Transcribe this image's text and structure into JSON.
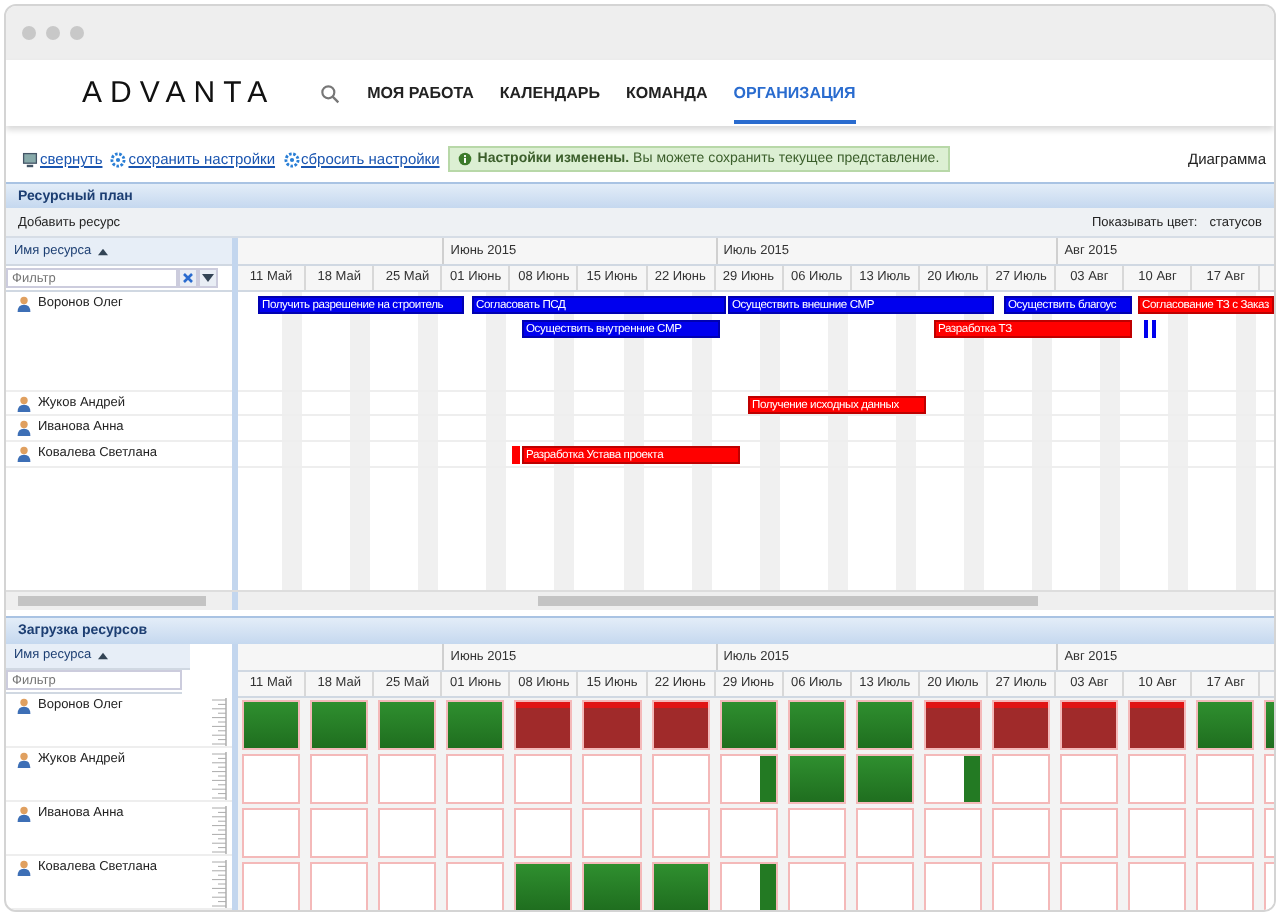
{
  "logo": "ADVANTA",
  "nav": [
    {
      "label": "МОЯ РАБОТА",
      "selected": false
    },
    {
      "label": "КАЛЕНДАРЬ",
      "selected": false
    },
    {
      "label": "КОМАНДА",
      "selected": false
    },
    {
      "label": "ОРГАНИЗАЦИЯ",
      "selected": true
    }
  ],
  "toolbar": {
    "links": [
      "свернуть",
      "сохранить настройки",
      "сбросить настройки"
    ],
    "notice": "**Настройки изменены.** Вы можете сохранить текущее представление.",
    "view_label": "Диаграмма"
  },
  "resource_plan": {
    "title": "Ресурсный план",
    "add_button": "Добавить ресурс",
    "color_label": "Показывать цвет:",
    "color_value": "статусов",
    "name_header": "Имя ресурса",
    "filter_placeholder": "Фильтр",
    "months": [
      "Июнь 2015",
      "Июль 2015",
      "Авг 2015"
    ],
    "weeks": [
      "11 Май",
      "18 Май",
      "25 Май",
      "01 Июнь",
      "08 Июнь",
      "15 Июнь",
      "22 Июнь",
      "29 Июнь",
      "06 Июль",
      "13 Июль",
      "20 Июль",
      "27 Июль",
      "03 Авг",
      "10 Авг",
      "17 Авг"
    ],
    "resources": [
      {
        "name": "Воронов Олег",
        "tasks": [
          {
            "kind": "task",
            "label": "Получить разрешение на строитель",
            "color": "#0000ee"
          },
          {
            "kind": "task",
            "label": "Согласовать ПСД",
            "color": "#0000ee"
          },
          {
            "kind": "task",
            "label": "Осуществить внешние СМР",
            "color": "#0000ee"
          },
          {
            "kind": "task",
            "label": "Осуществить благоус",
            "color": "#0000ee"
          },
          {
            "kind": "task",
            "label": "Согласование ТЗ с Заказ",
            "color": "#ff0000"
          },
          {
            "kind": "task",
            "label": "Осуществить внутренние СМР",
            "color": "#0000ee"
          },
          {
            "kind": "task",
            "label": "Разработка ТЗ",
            "color": "#ff0000"
          },
          {
            "kind": "marker",
            "color": "#0000ee"
          }
        ]
      },
      {
        "name": "Жуков Андрей",
        "tasks": [
          {
            "kind": "task",
            "label": "Получение исходных данных",
            "color": "#ff0000"
          }
        ]
      },
      {
        "name": "Иванова Анна"
      },
      {
        "name": "Ковалева Светлана",
        "tasks": [
          {
            "kind": "marker",
            "color": "#ff0000"
          },
          {
            "kind": "task",
            "label": "Разработка Устава проекта",
            "color": "#ff0000"
          }
        ]
      }
    ]
  },
  "resource_load": {
    "title": "Загрузка ресурсов",
    "name_header": "Имя ресурса",
    "filter_placeholder": "Фильтр",
    "months": [
      "Июнь 2015",
      "Июль 2015",
      "Авг 2015"
    ],
    "weeks": [
      "11 Май",
      "18 Май",
      "25 Май",
      "01 Июнь",
      "08 Июнь",
      "15 Июнь",
      "22 Июнь",
      "29 Июнь",
      "06 Июль",
      "13 Июль",
      "20 Июль",
      "27 Июль",
      "03 Авг",
      "10 Авг",
      "17 Авг"
    ],
    "resources": [
      {
        "name": "Воронов Олег",
        "load": [
          {
            "kind": "busy"
          },
          {
            "kind": "busy"
          },
          {
            "kind": "busy"
          },
          {
            "kind": "busy"
          },
          {
            "kind": "over"
          },
          {
            "kind": "over"
          },
          {
            "kind": "over"
          },
          {
            "kind": "busy"
          },
          {
            "kind": "busy"
          },
          {
            "kind": "busy"
          },
          {
            "kind": "over"
          },
          {
            "kind": "over"
          },
          {
            "kind": "over"
          },
          {
            "kind": "over"
          },
          {
            "kind": "busy"
          },
          {
            "kind": "busy"
          }
        ]
      },
      {
        "name": "Жуков Андрей",
        "load": [
          {
            "kind": "free"
          },
          {
            "kind": "free"
          },
          {
            "kind": "free"
          },
          {
            "kind": "free"
          },
          {
            "kind": "free"
          },
          {
            "kind": "free"
          },
          {
            "kind": "free"
          },
          {
            "kind": "part"
          },
          {
            "kind": "busy"
          },
          {
            "kind": "busy"
          },
          {
            "kind": "part"
          },
          {
            "kind": "free"
          },
          {
            "kind": "free"
          },
          {
            "kind": "free"
          },
          {
            "kind": "free"
          },
          {
            "kind": "free"
          }
        ]
      },
      {
        "name": "Иванова Анна",
        "load": [
          {
            "kind": "free"
          },
          {
            "kind": "free"
          },
          {
            "kind": "free"
          },
          {
            "kind": "free"
          },
          {
            "kind": "free"
          },
          {
            "kind": "free"
          },
          {
            "kind": "free"
          },
          {
            "kind": "free"
          },
          {
            "kind": "free"
          },
          {
            "kind": "free"
          },
          {
            "kind": "free"
          },
          {
            "kind": "free"
          },
          {
            "kind": "free"
          },
          {
            "kind": "free"
          },
          {
            "kind": "free"
          },
          {
            "kind": "free"
          }
        ]
      },
      {
        "name": "Ковалева Светлана",
        "load": [
          {
            "kind": "free"
          },
          {
            "kind": "free"
          },
          {
            "kind": "free"
          },
          {
            "kind": "free"
          },
          {
            "kind": "busy"
          },
          {
            "kind": "busy"
          },
          {
            "kind": "busy"
          },
          {
            "kind": "part"
          },
          {
            "kind": "free"
          },
          {
            "kind": "free"
          },
          {
            "kind": "free"
          },
          {
            "kind": "free"
          },
          {
            "kind": "free"
          },
          {
            "kind": "free"
          },
          {
            "kind": "free"
          },
          {
            "kind": "free"
          }
        ]
      }
    ]
  }
}
